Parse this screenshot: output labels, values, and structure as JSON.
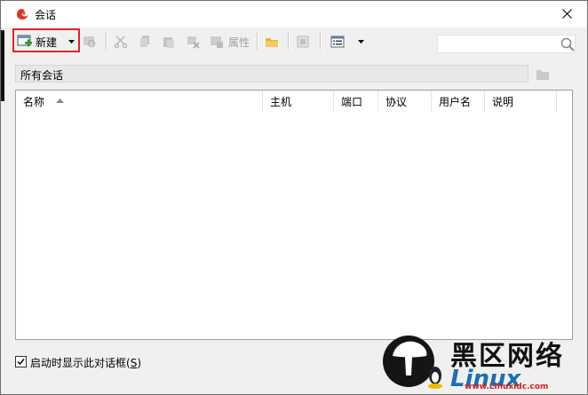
{
  "window": {
    "title": "会话"
  },
  "toolbar": {
    "new_label": "新建",
    "properties_label": "属性",
    "search": {
      "placeholder": "",
      "value": ""
    }
  },
  "path_bar": {
    "text": "所有会话"
  },
  "table": {
    "columns": [
      "名称",
      "主机",
      "端口",
      "协议",
      "用户名",
      "说明"
    ],
    "sort": {
      "column": "名称",
      "direction": "ascending"
    },
    "rows": []
  },
  "footer": {
    "checkbox_label": "启动时显示此对话框",
    "hotkey": "S",
    "checked": true
  },
  "watermark": {
    "cn_text": "黑区网络",
    "en_text": "Linux",
    "url": "www.Linuxidc.com"
  },
  "colors": {
    "highlight_border": "#e0252a",
    "accent_blue": "#1a6fb7",
    "window_bg": "#f0f0f0"
  }
}
